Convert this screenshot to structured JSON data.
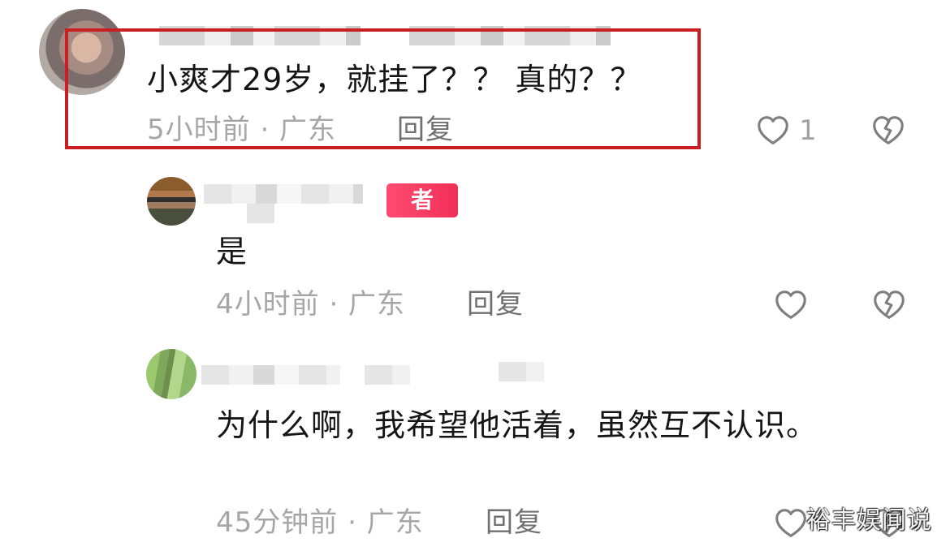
{
  "comments": [
    {
      "text": "小爽才29岁，就挂了？？ 真的？？",
      "meta": "5小时前 · 广东",
      "reply_label": "回复",
      "like_count": "1",
      "like_icon": "heart-outline-icon",
      "dislike_icon": "broken-heart-icon"
    },
    {
      "badge": "者",
      "text": "是",
      "meta": "4小时前 · 广东",
      "reply_label": "回复",
      "like_icon": "heart-outline-icon",
      "dislike_icon": "broken-heart-icon"
    },
    {
      "text": "为什么啊，我希望他活着，虽然互不认识。",
      "meta": "45分钟前 · 广东",
      "reply_label": "回复",
      "like_icon": "heart-outline-icon",
      "dislike_icon": "broken-heart-icon"
    }
  ],
  "watermark": "裕丰娱闻说",
  "colors": {
    "text": "#151515",
    "meta": "#a6a6a6",
    "reply": "#707070",
    "badge": "#f12f58",
    "highlight": "#c91f23"
  }
}
